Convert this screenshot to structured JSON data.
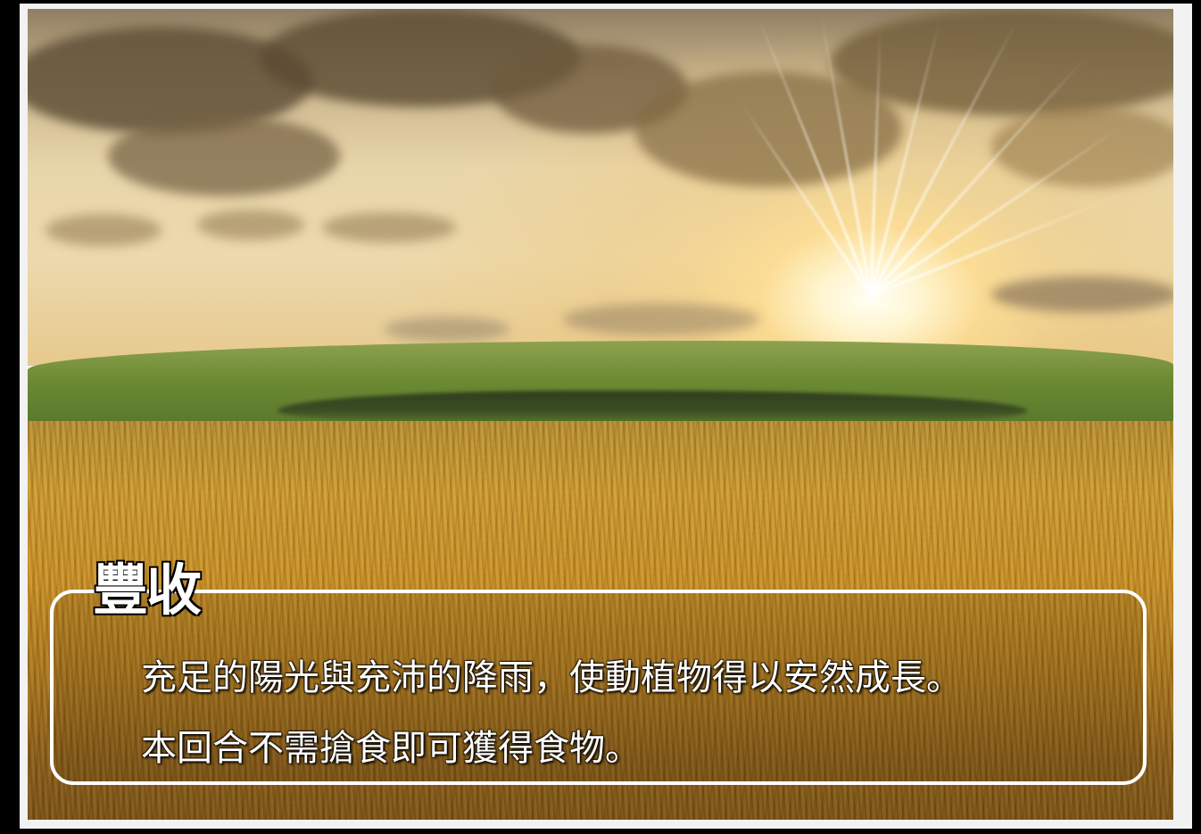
{
  "card": {
    "title": "豐收",
    "lines": [
      "充足的陽光與充沛的降雨，使動植物得以安然成長。",
      "本回合不需搶食即可獲得食物。"
    ]
  },
  "background": {
    "scene": "sunset-wheat-field-photo"
  },
  "colors": {
    "frame": "#000000",
    "panel_border": "#ffffff",
    "text": "#ffffff",
    "text_outline": "#000000"
  }
}
